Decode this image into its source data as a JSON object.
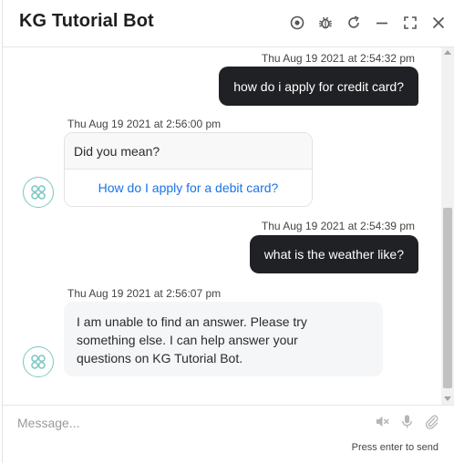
{
  "header": {
    "title": "KG Tutorial Bot",
    "icons": [
      "record-icon",
      "bug-icon",
      "refresh-icon",
      "minimize-icon",
      "expand-icon",
      "close-icon"
    ]
  },
  "conversation": [
    {
      "type": "user",
      "timestamp": "Thu Aug 19 2021 at 2:54:32 pm",
      "text": "how do i apply for credit card?"
    },
    {
      "type": "bot-disambiguation",
      "timestamp": "Thu Aug 19 2021 at 2:56:00 pm",
      "prompt": "Did you mean?",
      "option": "How do I apply for a debit card?"
    },
    {
      "type": "user",
      "timestamp": "Thu Aug 19 2021 at 2:54:39 pm",
      "text": "what is the weather like?"
    },
    {
      "type": "bot-text",
      "timestamp": "Thu Aug 19 2021 at 2:56:07 pm",
      "lines": [
        "I am unable to find an answer. Please try",
        "something else. I can help answer your",
        "questions on KG Tutorial Bot."
      ]
    }
  ],
  "composer": {
    "placeholder": "Message...",
    "hint": "Press enter to send",
    "icons": [
      "speaker-mute-icon",
      "microphone-icon",
      "attachment-icon"
    ]
  },
  "colors": {
    "user_bubble": "#1f2124",
    "link": "#1a73e8",
    "avatar_accent": "#7cc7c3"
  }
}
